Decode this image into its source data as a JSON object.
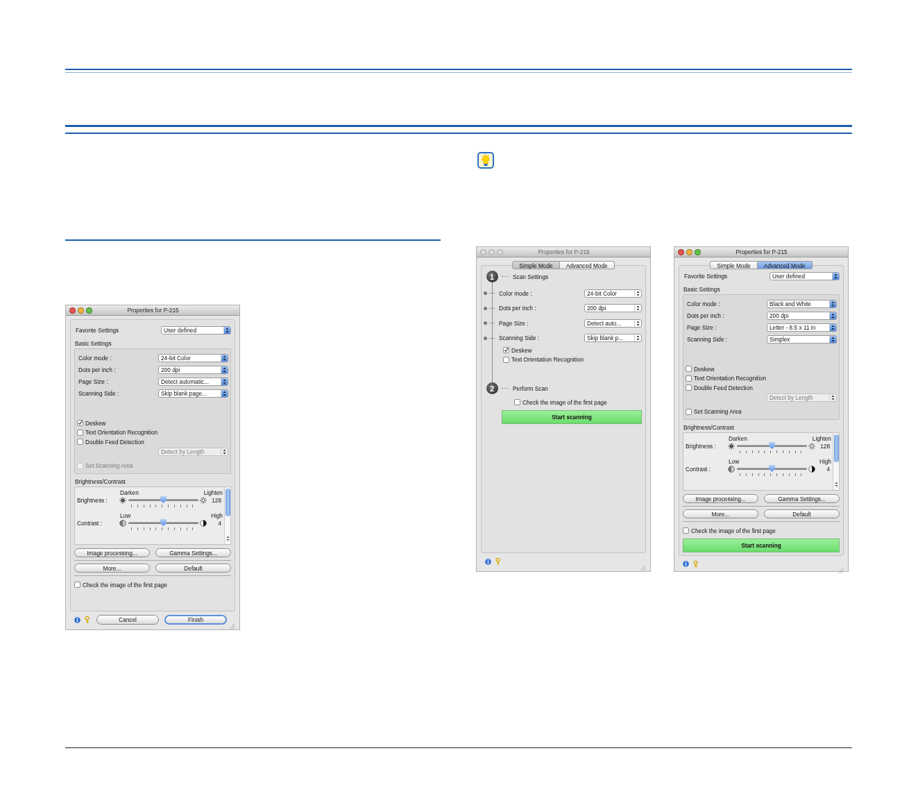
{
  "windows": [
    {
      "title": "Properties for P-215",
      "active": true,
      "sections": [
        {
          "kind": "favorite",
          "label": "Favorite Settings",
          "value": "User defined"
        },
        {
          "kind": "group",
          "title": "Basic Settings",
          "fields": [
            {
              "label": "Color mode :",
              "value": "24-bit Color"
            },
            {
              "label": "Dots per inch :",
              "value": "200 dpi"
            },
            {
              "label": "Page Size :",
              "value": "Detect automatic..."
            },
            {
              "label": "Scanning Side :",
              "value": "Skip blank page..."
            }
          ],
          "options": [
            {
              "kind": "checkbox",
              "label": "Deskew",
              "checked": true,
              "disabled": false
            },
            {
              "kind": "checkbox",
              "label": "Text Orientation Recognition",
              "checked": false,
              "disabled": false
            },
            {
              "kind": "checkbox",
              "label": "Double Feed Detection",
              "checked": false,
              "disabled": false
            },
            {
              "kind": "popup",
              "value": "Detect by Length",
              "disabled": true
            },
            {
              "kind": "checkbox",
              "label": "Set Scanning Area",
              "checked": false,
              "disabled": true
            }
          ]
        },
        {
          "kind": "adjust",
          "title": "Brightness/Contrast",
          "sliders": [
            {
              "label": "Brightness :",
              "low": "Darken",
              "high": "Lighten",
              "level": 0.5,
              "reading": "128"
            },
            {
              "label": "Contrast :",
              "low": "Low",
              "high": "High",
              "level": 0.5,
              "reading": "4"
            }
          ]
        },
        {
          "kind": "buttons",
          "buttons": [
            "Image processing...",
            "Gamma Settings..."
          ]
        },
        {
          "kind": "buttons",
          "buttons": [
            "More...",
            "Default"
          ]
        },
        {
          "kind": "checkbox",
          "label": "Check the image of the first page",
          "checked": false,
          "disabled": false
        }
      ],
      "footer_buttons": [
        {
          "label": "Cancel",
          "default": false
        },
        {
          "label": "Finish",
          "default": true
        }
      ]
    },
    {
      "title": "Properties for P-215",
      "active": false,
      "tabs": [
        {
          "label": "Simple Mode",
          "selected": true
        },
        {
          "label": "Advanced Mode",
          "selected": false
        }
      ],
      "sections": [
        {
          "kind": "step",
          "number": "1",
          "title": "Scan Settings",
          "fields": [
            {
              "label": "Color mode :",
              "value": "24-bit Color"
            },
            {
              "label": "Dots per inch :",
              "value": "200 dpi"
            },
            {
              "label": "Page Size :",
              "value": "Detect auto..."
            },
            {
              "label": "Scanning Side :",
              "value": "Skip blank p..."
            }
          ],
          "options": [
            {
              "kind": "checkbox",
              "label": "Deskew",
              "checked": true,
              "disabled": false
            },
            {
              "kind": "checkbox",
              "label": "Text Orientation Recognition",
              "checked": false,
              "disabled": false
            }
          ]
        },
        {
          "kind": "step",
          "number": "2",
          "title": "Perform Scan",
          "options": [
            {
              "kind": "checkbox",
              "label": "Check the image of the first page",
              "checked": false,
              "disabled": false
            }
          ],
          "start": "Start scanning"
        }
      ]
    },
    {
      "title": "Properties for P-215",
      "active": true,
      "tabs": [
        {
          "label": "Simple Mode",
          "selected": false
        },
        {
          "label": "Advanced Mode",
          "selected": true
        }
      ],
      "sections": [
        {
          "kind": "favorite",
          "label": "Favorite Settings",
          "value": "User defined"
        },
        {
          "kind": "group",
          "title": "Basic Settings",
          "fields": [
            {
              "label": "Color mode :",
              "value": "Black and White"
            },
            {
              "label": "Dots per inch :",
              "value": "200 dpi"
            },
            {
              "label": "Page Size :",
              "value": "Letter - 8.5 x 11 in"
            },
            {
              "label": "Scanning Side :",
              "value": "Simplex"
            }
          ],
          "options": [
            {
              "kind": "checkbox",
              "label": "Deskew",
              "checked": false,
              "disabled": false
            },
            {
              "kind": "checkbox",
              "label": "Text Orientation Recognition",
              "checked": false,
              "disabled": false
            },
            {
              "kind": "checkbox",
              "label": "Double Feed Detection",
              "checked": false,
              "disabled": false
            },
            {
              "kind": "popup",
              "value": "Detect by Length",
              "disabled": true
            },
            {
              "kind": "checkbox",
              "label": "Set Scanning Area",
              "checked": false,
              "disabled": false
            }
          ]
        },
        {
          "kind": "adjust",
          "title": "Brightness/Contrast",
          "sliders": [
            {
              "label": "Brightness :",
              "low": "Darken",
              "high": "Lighten",
              "level": 0.5,
              "reading": "128"
            },
            {
              "label": "Contrast :",
              "low": "Low",
              "high": "High",
              "level": 0.5,
              "reading": "4"
            }
          ]
        },
        {
          "kind": "buttons",
          "buttons": [
            "Image processing...",
            "Gamma Settings..."
          ]
        },
        {
          "kind": "buttons",
          "buttons": [
            "More...",
            "Default"
          ]
        },
        {
          "kind": "checkbox",
          "label": "Check the image of the first page",
          "checked": false,
          "disabled": false
        },
        {
          "kind": "start",
          "label": "Start scanning"
        }
      ]
    }
  ]
}
